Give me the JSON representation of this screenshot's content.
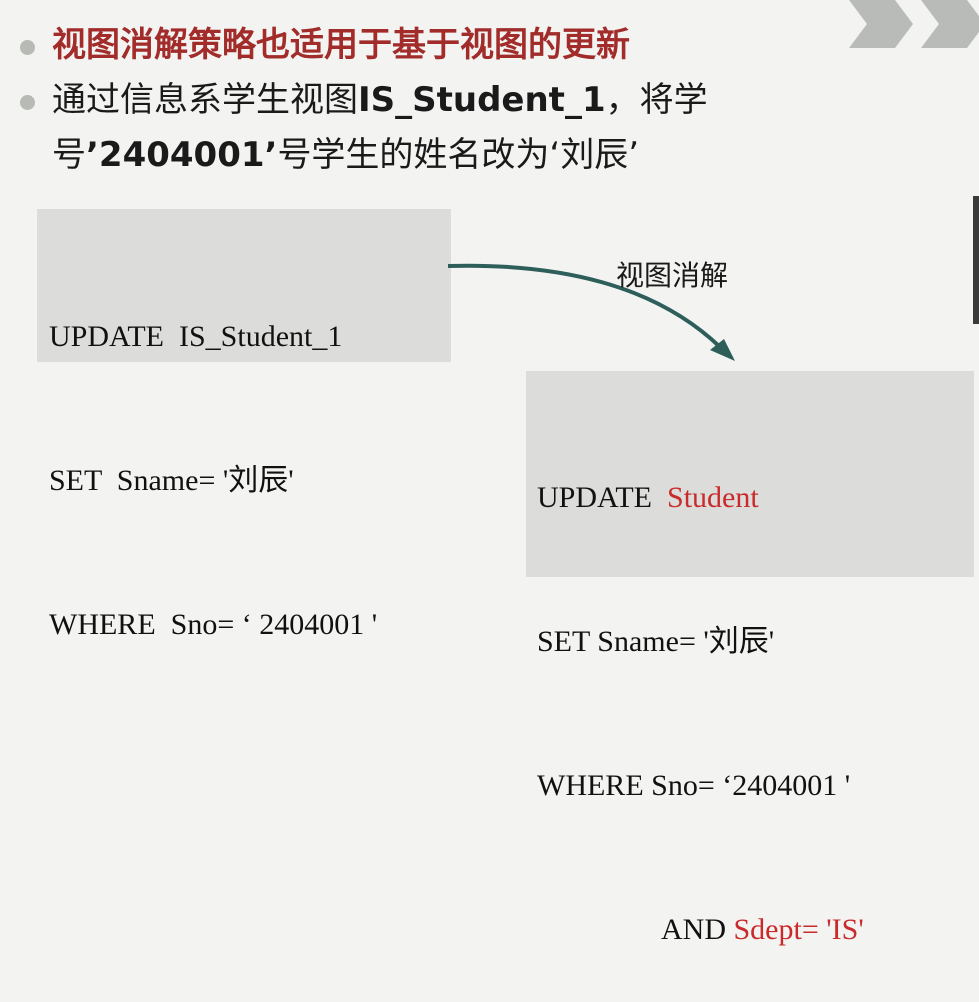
{
  "bullets": {
    "item1": "视图消解策略也适用于基于视图的更新",
    "item2_part1": "通过信息系学生视图",
    "item2_view": "IS_Student_1",
    "item2_part2": "，将学",
    "item2_line2_a": "号",
    "item2_sno": "’2404001’",
    "item2_line2_b": "号学生的姓名改为‘刘辰’"
  },
  "original_sql": {
    "line1": "UPDATE  IS_Student_1",
    "line2": "SET  Sname= '刘辰'",
    "line3": "WHERE  Sno= ‘ 2404001 '"
  },
  "arrow_label": "视图消解",
  "resolved_sql": {
    "line1_kw": "UPDATE  ",
    "line1_table": "Student",
    "line2": "SET Sname= '刘辰'",
    "line3": "WHERE Sno= ‘2404001 '",
    "line4_kw": "AND ",
    "line4_cond": "Sdept= 'IS'"
  },
  "colors": {
    "title_red": "#a12c2a",
    "highlight_red": "#c92a2a",
    "arrow": "#2e5e5a",
    "box_bg": "#dcdddb"
  }
}
